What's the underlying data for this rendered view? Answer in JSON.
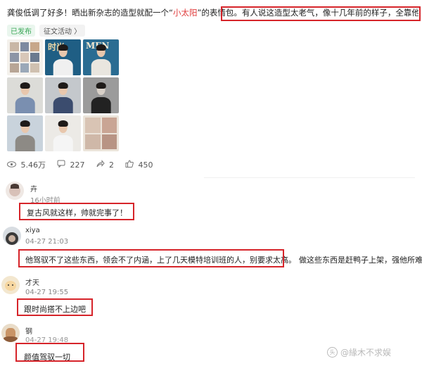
{
  "post": {
    "text_before": "龚俊低调了好多！晒出新杂志的造型就配一个“",
    "text_highlight": "小太阳",
    "text_after": "”的表情包。",
    "text_boxed": "有人说这造型太老气，像十几年前的样子，全靠他颜值撑起来",
    "tag_published": "已发布",
    "tag_activity": "征文活动 〉",
    "magazine_label": "MEN",
    "magazine_label_alt": "时尚",
    "highlight_color": "#e03b3b"
  },
  "stats": {
    "views": "5.46万",
    "comments": "227",
    "shares": "2",
    "likes": "450",
    "views_icon": "eye-icon",
    "comments_icon": "comment-icon",
    "shares_icon": "share-icon",
    "likes_icon": "thumbs-up-icon"
  },
  "comments": [
    {
      "name": "卉",
      "time": "16小时前",
      "text": "复古风就这样，帅就完事了！",
      "text_extra": ""
    },
    {
      "name": "xiya",
      "time": "04-27 21:03",
      "text": "他驾驭不了这些东西，领会不了内涵，上了几天模特培训班的人，别要求太高。",
      "text_extra": "做这些东西是赶鸭子上架，强他所难"
    },
    {
      "name": "才天",
      "time": "04-27 19:55",
      "text": "跟时尚搭不上边吧",
      "text_extra": ""
    },
    {
      "name": "钢",
      "time": "04-27 19:48",
      "text": "颜值驾驭一切",
      "text_extra": ""
    }
  ],
  "watermark": {
    "text": "@緣木不求娱",
    "icon": "watermark-logo-icon"
  },
  "colors": {
    "box_red": "#d6242a",
    "published_green": "#3aa757"
  }
}
